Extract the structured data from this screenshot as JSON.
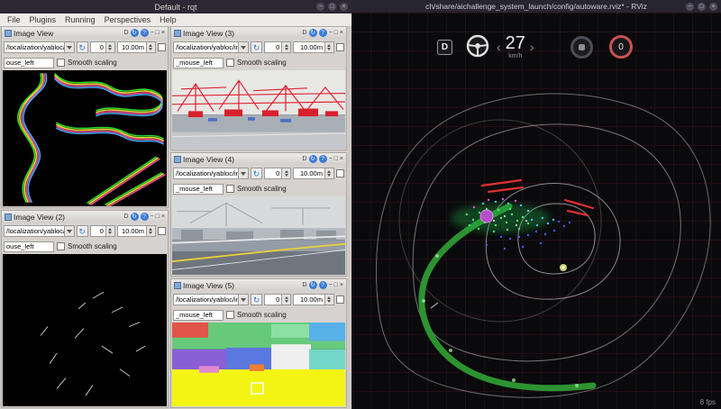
{
  "rqt": {
    "title": "Default - rqt",
    "menu": [
      "File",
      "Plugins",
      "Running",
      "Perspectives",
      "Help"
    ],
    "panel_controls": {
      "dock": "D",
      "refresh": "↻",
      "help": "?",
      "minimize": "−",
      "float": "□",
      "close": "×"
    },
    "toolbar": {
      "rotate_value": "0",
      "depth_value": "10.00m",
      "smooth_label": "Smooth scaling"
    },
    "panels": [
      {
        "title": "Image View",
        "topic": "/localization/yabloc/i",
        "mouse_field": "ouse_left"
      },
      {
        "title": "Image View (2)",
        "topic": "/localization/yabloc/i",
        "mouse_field": "ouse_left"
      },
      {
        "title": "Image View (3)",
        "topic": "/localization/yabloc/ima",
        "mouse_field": "_mouse_left"
      },
      {
        "title": "Image View (4)",
        "topic": "/localization/yabloc/ima",
        "mouse_field": "_mouse_left"
      },
      {
        "title": "Image View (5)",
        "topic": "/localization/yabloc/ima",
        "mouse_field": "_mouse_left"
      }
    ]
  },
  "rviz": {
    "title": "ch/share/aichallenge_system_launch/config/autoware.rviz* - RViz",
    "overlay": {
      "gear": "D",
      "speed": "27",
      "speed_unit": "km/h",
      "chevron_left": "‹",
      "chevron_right": "›",
      "steer_value": "0"
    },
    "fps": "8 fps"
  },
  "colors": {
    "trajectory_green": "#2e9b33",
    "vehicle_purple": "#b44fc9",
    "detection_red": "#e03030",
    "segmentation_yellow": "#f4f414"
  }
}
